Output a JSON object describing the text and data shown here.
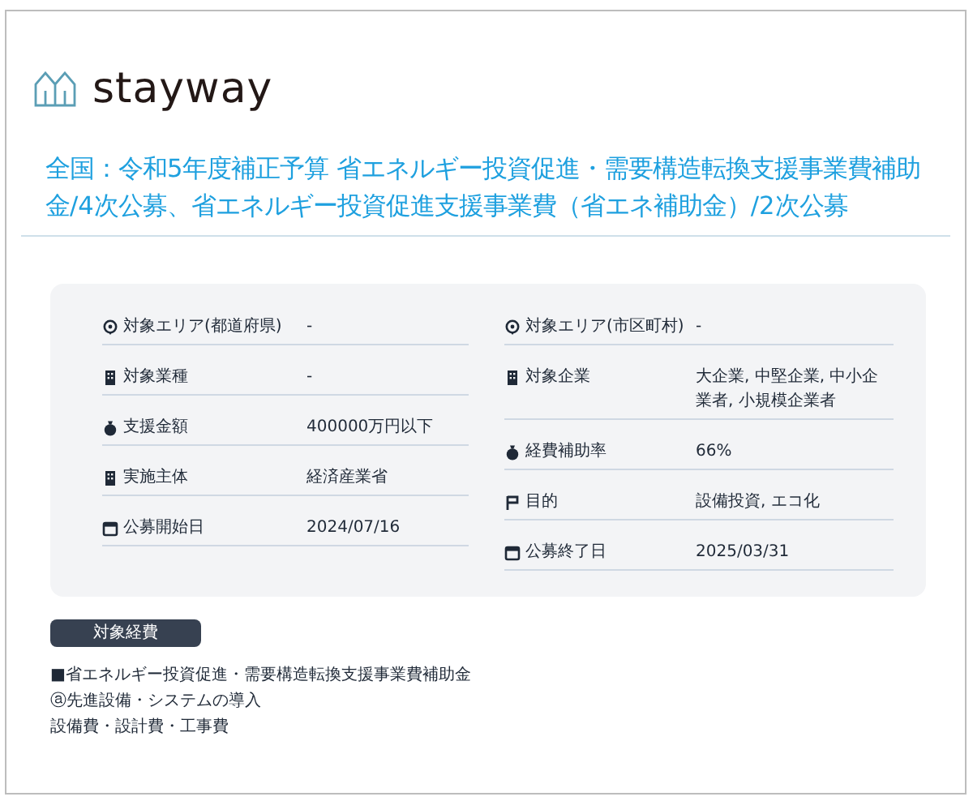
{
  "logo": {
    "text": "stayway"
  },
  "title": "全国：令和5年度補正予算 省エネルギー投資促進・需要構造転換支援事業費補助金/4次公募、省エネルギー投資促進支援事業費（省エネ補助金）/2次公募",
  "details": {
    "left": [
      {
        "kind": "pin",
        "label": "対象エリア(都道府県)",
        "value": "-"
      },
      {
        "kind": "building",
        "label": "対象業種",
        "value": "-"
      },
      {
        "kind": "money",
        "label": "支援金額",
        "value": "400000万円以下"
      },
      {
        "kind": "building",
        "label": "実施主体",
        "value": "経済産業省"
      },
      {
        "kind": "calendar",
        "label": "公募開始日",
        "value": "2024/07/16"
      }
    ],
    "right": [
      {
        "kind": "pin",
        "label": "対象エリア(市区町村)",
        "value": "-"
      },
      {
        "kind": "building",
        "label": "対象企業",
        "value": "大企業, 中堅企業, 中小企業者, 小規模企業者"
      },
      {
        "kind": "money",
        "label": "経費補助率",
        "value": "66%"
      },
      {
        "kind": "flag",
        "label": "目的",
        "value": "設備投資, エコ化"
      },
      {
        "kind": "calendar",
        "label": "公募終了日",
        "value": "2025/03/31"
      }
    ]
  },
  "expenses": {
    "badge": "対象経費",
    "lines": [
      "■省エネルギー投資促進・需要構造転換支援事業費補助金",
      "ⓐ先進設備・システムの導入",
      "設備費・設計費・工事費"
    ]
  }
}
